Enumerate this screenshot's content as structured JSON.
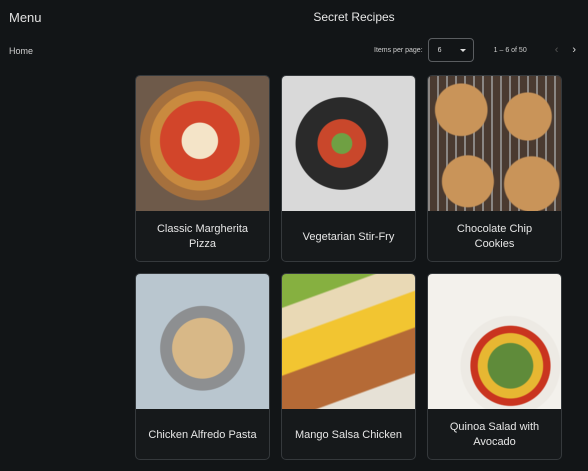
{
  "sidebar": {
    "title": "Menu",
    "items": [
      {
        "label": "Home"
      }
    ]
  },
  "header": {
    "title": "Secret Recipes"
  },
  "paginator": {
    "items_per_page_label": "Items per page:",
    "items_per_page": "6",
    "range": "1 – 6 of 50",
    "prev": "‹",
    "next": "›"
  },
  "recipes": [
    {
      "title": "Classic Margherita Pizza"
    },
    {
      "title": "Vegetarian Stir-Fry"
    },
    {
      "title": "Chocolate Chip Cookies"
    },
    {
      "title": "Chicken Alfredo Pasta"
    },
    {
      "title": "Mango Salsa Chicken"
    },
    {
      "title": "Quinoa Salad with Avocado"
    }
  ]
}
